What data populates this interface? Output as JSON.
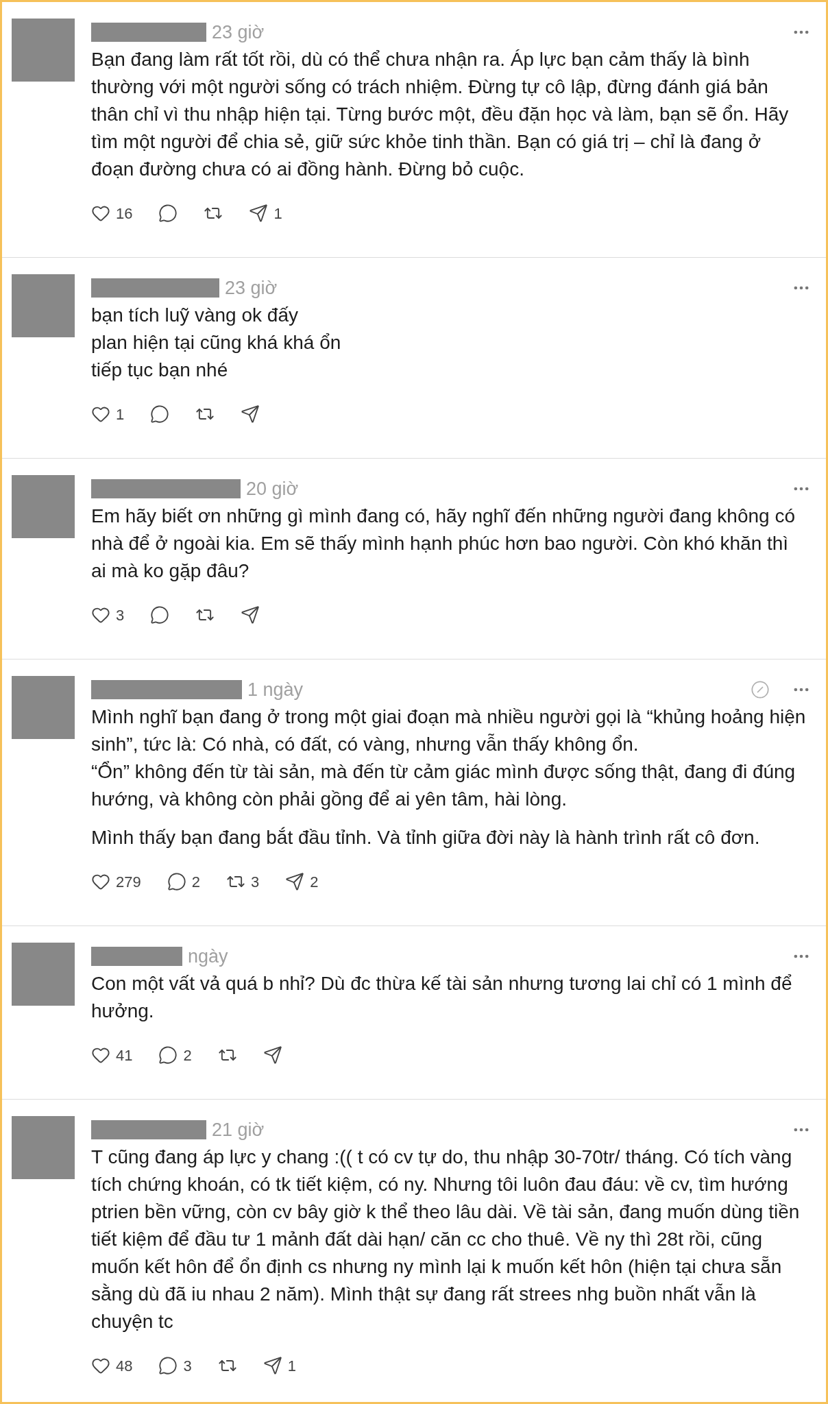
{
  "posts": [
    {
      "time": "23 giờ",
      "status_icon": false,
      "paragraphs": [
        [
          "Bạn đang làm rất tốt rồi, dù có thể chưa nhận ra. Áp lực bạn cảm thấy là bình thường với một người sống có trách nhiệm. Đừng tự cô lập, đừng đánh giá bản thân chỉ vì thu nhập hiện tại. Từng bước một, đều đặn học và làm, bạn sẽ ổn. Hãy tìm một người để chia sẻ, giữ sức khỏe tinh thần. Bạn có giá trị – chỉ là đang ở đoạn đường chưa có ai đồng hành. Đừng bỏ cuộc."
        ]
      ],
      "likes": "16",
      "shares": "1"
    },
    {
      "time": "23 giờ",
      "status_icon": false,
      "paragraphs": [
        [
          "bạn tích luỹ vàng ok đấy",
          "plan hiện tại cũng khá khá ổn",
          "tiếp tục bạn nhé"
        ]
      ],
      "likes": "1"
    },
    {
      "time": "20 giờ",
      "status_icon": false,
      "paragraphs": [
        [
          "Em hãy biết ơn những gì mình đang có, hãy nghĩ đến những người đang không có nhà để ở ngoài kia. Em sẽ thấy mình hạnh phúc hơn bao người. Còn khó khăn thì ai mà ko gặp đâu?"
        ]
      ],
      "likes": "3"
    },
    {
      "time": "1 ngày",
      "status_icon": true,
      "paragraphs": [
        [
          "Mình nghĩ bạn đang ở trong một giai đoạn mà nhiều người gọi là “khủng hoảng hiện sinh”, tức là: Có nhà, có đất, có vàng, nhưng vẫn thấy không ổn.",
          "“Ổn” không đến từ tài sản, mà đến từ cảm giác mình được sống thật, đang đi đúng hướng, và không còn phải gồng để ai yên tâm, hài lòng."
        ],
        [
          "Mình thấy bạn đang bắt đầu tỉnh. Và tỉnh giữa đời này là hành trình rất cô đơn."
        ]
      ],
      "likes": "279",
      "replies": "2",
      "reposts": "3",
      "shares": "2"
    },
    {
      "time": "ngày",
      "status_icon": false,
      "paragraphs": [
        [
          "Con một vất vả quá b nhỉ? Dù đc thừa kế tài sản nhưng tương lai chỉ có 1 mình để hưởng."
        ]
      ],
      "likes": "41",
      "replies": "2"
    },
    {
      "time": "21 giờ",
      "status_icon": false,
      "paragraphs": [
        [
          "T cũng đang áp lực y chang :(( t có cv tự do, thu nhập 30-70tr/ tháng. Có tích vàng tích chứng khoán, có tk tiết kiệm, có ny. Nhưng tôi luôn đau đáu: về cv, tìm hướng ptrien bền vững, còn cv bây giờ k thể theo lâu dài. Về tài sản, đang muốn dùng tiền tiết kiệm để đầu tư 1 mảnh đất dài hạn/ căn cc cho thuê. Về ny thì 28t rồi, cũng muốn kết hôn để ổn định cs nhưng ny mình lại k muốn kết hôn (hiện tại chưa sẵn sằng dù đã iu nhau 2 năm). Mình thật sự đang rất strees nhg buồn nhất vẫn là chuyện tc"
        ]
      ],
      "likes": "48",
      "replies": "3",
      "shares": "1"
    }
  ]
}
